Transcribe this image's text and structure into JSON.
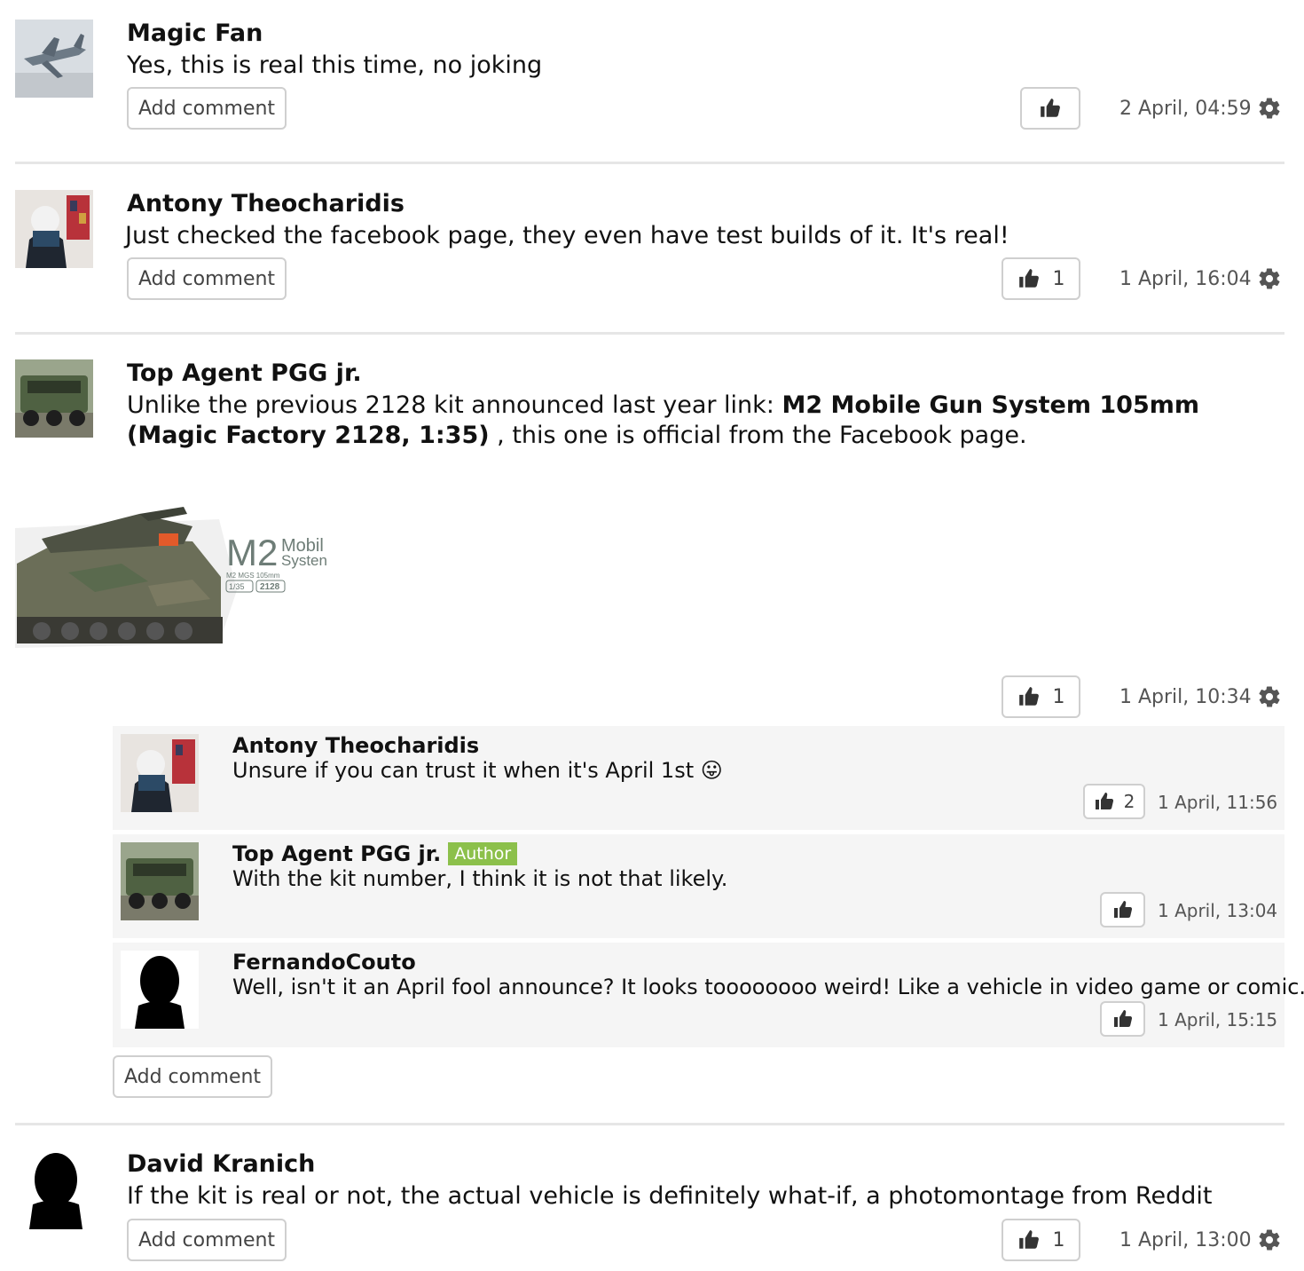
{
  "comments": [
    {
      "author": "Magic Fan",
      "text": "Yes, this is real this time, no joking",
      "add_comment": "Add comment",
      "likes": "",
      "timestamp": "2 April, 04:59",
      "avatar_icon": "airplane-model-photo"
    },
    {
      "author": "Antony Theocharidis",
      "text": "Just checked the facebook page, they even have test builds of it. It's real!",
      "add_comment": "Add comment",
      "likes": "1",
      "timestamp": "1 April, 16:04",
      "avatar_icon": "person-photo"
    },
    {
      "author": "Top Agent PGG jr.",
      "text_before": "Unlike the previous 2128 kit announced last year link: ",
      "link": "M2 Mobile Gun System 105mm (Magic Factory 2128, 1:35)",
      "text_after": " , this one is official from the Facebook page.",
      "image_caption": {
        "line1": "M2",
        "line2": "Mobil",
        "line3": "Systen",
        "small": "M2 MGS 105mm",
        "scale": "1/35",
        "kit": "2128"
      },
      "likes": "1",
      "timestamp": "1 April, 10:34",
      "avatar_icon": "truck-photo",
      "replies": [
        {
          "author": "Antony Theocharidis",
          "text": "Unsure if you can trust it when it's April 1st",
          "emoji": "😛",
          "likes": "2",
          "timestamp": "1 April, 11:56"
        },
        {
          "author": "Top Agent PGG jr.",
          "badge": "Author",
          "text": "With the kit number, I think it is not that likely.",
          "likes": "",
          "timestamp": "1 April, 13:04"
        },
        {
          "author": "FernandoCouto",
          "text": "Well, isn't it an April fool announce? It looks toooooooo weird! Like a vehicle in video game or comic.",
          "likes": "",
          "timestamp": "1 April, 15:15"
        }
      ],
      "add_comment": "Add comment"
    },
    {
      "author": "David Kranich",
      "text": "If the kit is real or not, the actual vehicle is definitely what-if, a photomontage from Reddit",
      "add_comment": "Add comment",
      "likes": "1",
      "timestamp": "1 April, 13:00",
      "avatar_icon": "silhouette-avatar"
    }
  ],
  "colors": {
    "author_badge": "#8cc04b",
    "reply_bg": "#f5f5f5",
    "divider": "#e6e6e6"
  }
}
